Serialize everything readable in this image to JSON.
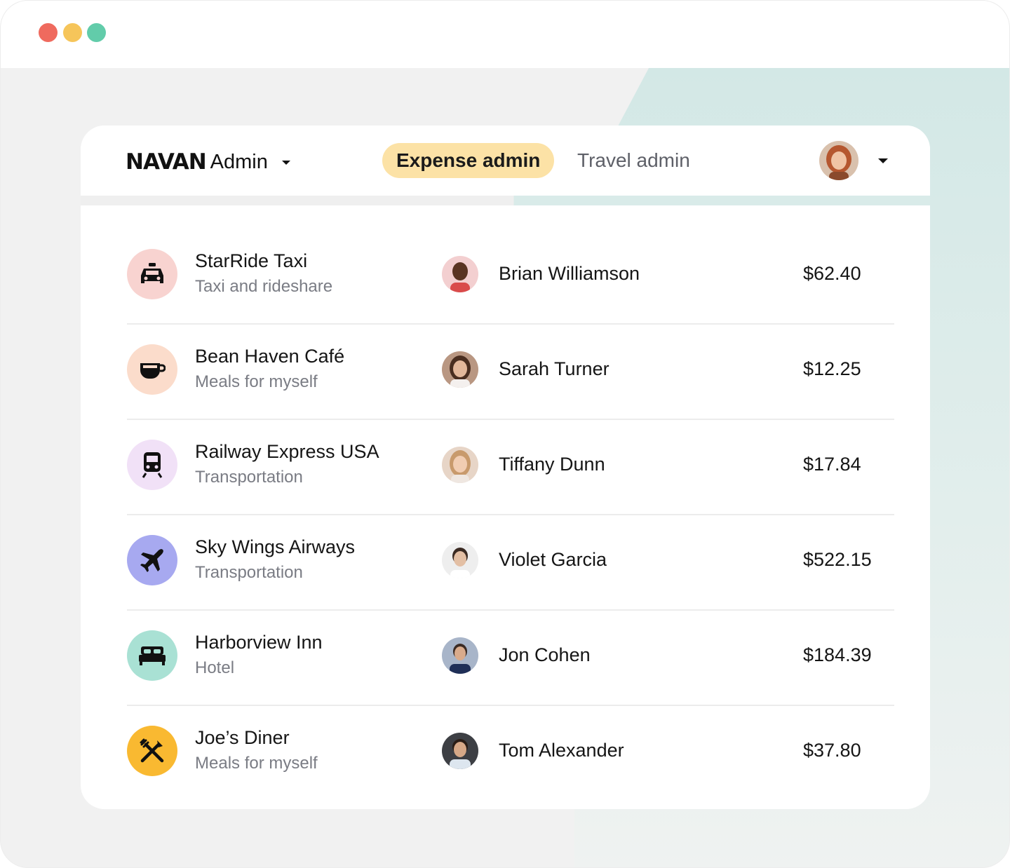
{
  "window": {
    "controls": [
      "close",
      "minimize",
      "maximize"
    ],
    "colors": {
      "close": "#ef6a5e",
      "minimize": "#f6c55a",
      "maximize": "#62ccaa"
    }
  },
  "header": {
    "logo_text": "NAVAN",
    "logo_suffix": "Admin",
    "tabs": [
      {
        "label": "Expense admin",
        "active": true
      },
      {
        "label": "Travel admin",
        "active": false
      }
    ],
    "active_tab_color": "#fce2a6"
  },
  "expenses": [
    {
      "merchant": "StarRide Taxi",
      "category": "Taxi and rideshare",
      "icon": "car-icon",
      "icon_bg": "#f8d3d0",
      "employee": "Brian Williamson",
      "amount": "$62.40"
    },
    {
      "merchant": "Bean Haven Café",
      "category": "Meals for myself",
      "icon": "coffee-cup-icon",
      "icon_bg": "#fbdccb",
      "employee": "Sarah Turner",
      "amount": "$12.25"
    },
    {
      "merchant": "Railway Express USA",
      "category": "Transportation",
      "icon": "train-icon",
      "icon_bg": "#f1e1f7",
      "employee": "Tiffany Dunn",
      "amount": "$17.84"
    },
    {
      "merchant": "Sky Wings Airways",
      "category": "Transportation",
      "icon": "airplane-icon",
      "icon_bg": "#a7a9f0",
      "employee": "Violet Garcia",
      "amount": "$522.15"
    },
    {
      "merchant": "Harborview Inn",
      "category": "Hotel",
      "icon": "bed-icon",
      "icon_bg": "#a9e1d4",
      "employee": "Jon Cohen",
      "amount": "$184.39"
    },
    {
      "merchant": "Joe’s Diner",
      "category": "Meals for myself",
      "icon": "fork-knife-icon",
      "icon_bg": "#f9b931",
      "employee": "Tom Alexander",
      "amount": "$37.80"
    }
  ]
}
